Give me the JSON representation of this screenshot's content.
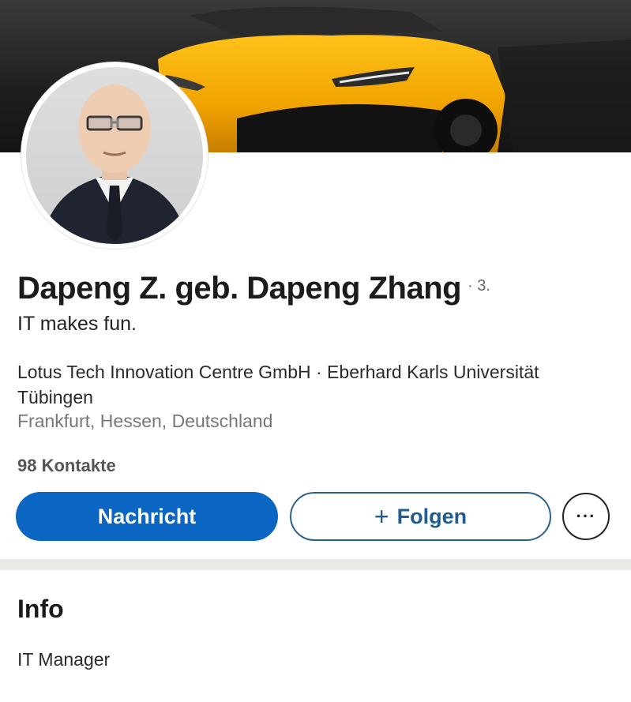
{
  "profile": {
    "name": "Dapeng Z. geb. Dapeng Zhang",
    "degree": "· 3.",
    "headline": "IT makes fun.",
    "company_line": "Lotus Tech Innovation Centre GmbH · Eberhard Karls Universität Tübingen",
    "location": "Frankfurt, Hessen, Deutschland",
    "contacts": "98 Kontakte"
  },
  "actions": {
    "message_label": "Nachricht",
    "follow_plus": "+",
    "follow_label": "Folgen",
    "more_label": "···"
  },
  "info": {
    "title": "Info",
    "text": "IT Manager"
  },
  "colors": {
    "primary_button": "#0a66c2",
    "follow_border": "#2b5e8a",
    "cover_car": "#f5a800"
  },
  "icons": {
    "more": "ellipsis-icon",
    "follow": "plus-icon"
  }
}
